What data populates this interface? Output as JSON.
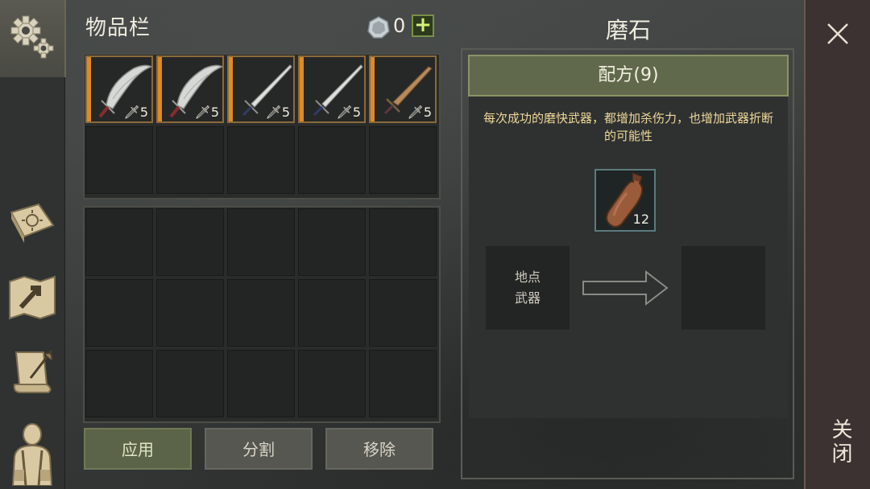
{
  "inventory": {
    "title": "物品栏",
    "currency_icon": "silver-coin-icon",
    "currency_count": "0",
    "add_currency_label": "+",
    "weapon_slots": [
      {
        "icon": "scimitar-icon",
        "quality_color": "#e08a25",
        "tag": "5"
      },
      {
        "icon": "scimitar-icon",
        "quality_color": "#e08a25",
        "tag": "5"
      },
      {
        "icon": "longsword-icon",
        "quality_color": "#e08a25",
        "tag": "5"
      },
      {
        "icon": "longsword-icon",
        "quality_color": "#e08a25",
        "tag": "5"
      },
      {
        "icon": "bronze-sword-icon",
        "quality_color": "#e08a25",
        "tag": "5"
      }
    ],
    "buttons": {
      "apply": "应用",
      "split": "分割",
      "remove": "移除"
    }
  },
  "crafting": {
    "title": "磨石",
    "recipe_label": "配方(9)",
    "description": "每次成功的磨快武器，都增加杀伤力，也增加武器折断的可能性",
    "required_item": {
      "icon": "oil-bottle-icon",
      "count": "12"
    },
    "input_slot": {
      "line1": "地点",
      "line2": "武器"
    }
  },
  "close": {
    "label": "关闭"
  },
  "sidebar": {
    "tabs": [
      "settings-gear-icon",
      "skills-book-icon",
      "map-icon",
      "quest-scroll-icon",
      "character-icon"
    ]
  }
}
